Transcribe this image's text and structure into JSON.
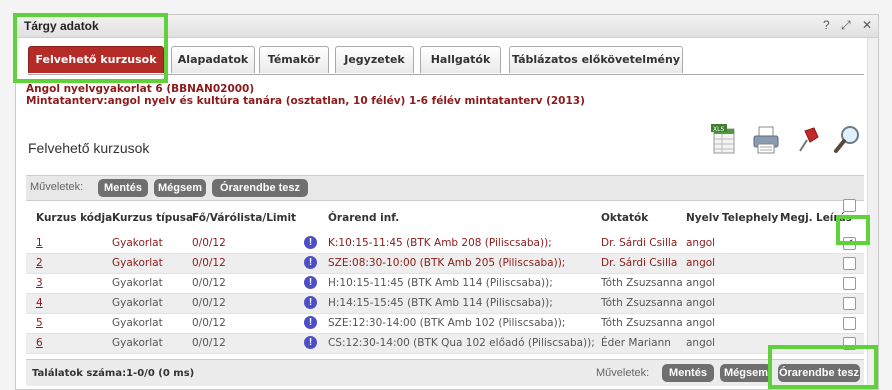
{
  "window": {
    "title": "Tárgy adatok",
    "help_icon": "?",
    "popout_icon": "⤢",
    "close_icon": "✕"
  },
  "tabs": [
    {
      "label": "Felvehető kurzusok",
      "active": true
    },
    {
      "label": "Alapadatok"
    },
    {
      "label": "Témakör"
    },
    {
      "label": "Jegyzetek"
    },
    {
      "label": "Hallgatók"
    },
    {
      "label": "Táblázatos előkövetelmény"
    }
  ],
  "course": {
    "line1": "Angol nyelvgyakorlat 6 (BBNAN02000)",
    "line2": "Mintatanterv:angol nyelv és kultúra tanára (osztatlan, 10 félév) 1-6 félév mintatanterv (2013)"
  },
  "section": {
    "title": "Felvehető kurzusok"
  },
  "toolbar": {
    "icons": [
      "xls-export-icon",
      "print-icon",
      "pin-icon",
      "search-icon"
    ]
  },
  "actions": {
    "label": "Műveletek:",
    "save": "Mentés",
    "cancel": "Mégsem",
    "schedule": "Órarendbe tesz"
  },
  "columns": {
    "code": "Kurzus kódja",
    "type": "Kurzus típusa",
    "limit": "Fő/Várólista/Limit",
    "schedule": "Órarend inf.",
    "teacher": "Oktatók",
    "lang": "Nyelv",
    "site": "Telephely",
    "note": "Megj.",
    "desc": "Leírás"
  },
  "rows": [
    {
      "code": "1",
      "type": "Gyakorlat",
      "limit": "0/0/12",
      "schedule": "K:10:15-11:45 (BTK Amb 208 (Piliscsaba));",
      "teacher": "Dr. Sárdi Csilla",
      "lang": "angol",
      "checked": "✔"
    },
    {
      "code": "2",
      "type": "Gyakorlat",
      "limit": "0/0/12",
      "schedule": "SZE:08:30-10:00 (BTK Amb 205 (Piliscsaba));",
      "teacher": "Dr. Sárdi Csilla",
      "lang": "angol",
      "checked": ""
    },
    {
      "code": "3",
      "type": "Gyakorlat",
      "limit": "0/0/12",
      "schedule": "H:10:15-11:45 (BTK Amb 114 (Piliscsaba));",
      "teacher": "Tóth Zsuzsanna",
      "lang": "angol",
      "checked": ""
    },
    {
      "code": "4",
      "type": "Gyakorlat",
      "limit": "0/0/12",
      "schedule": "H:14:15-15:45 (BTK Amb 114 (Piliscsaba));",
      "teacher": "Tóth Zsuzsanna",
      "lang": "angol",
      "checked": ""
    },
    {
      "code": "5",
      "type": "Gyakorlat",
      "limit": "0/0/12",
      "schedule": "SZE:12:30-14:00 (BTK Amb 102 (Piliscsaba));",
      "teacher": "Tóth Zsuzsanna",
      "lang": "angol",
      "checked": ""
    },
    {
      "code": "6",
      "type": "Gyakorlat",
      "limit": "0/0/12",
      "schedule": "CS:12:30-14:00 (BTK Qua 102 előadó (Piliscsaba));",
      "teacher": "Éder Mariann",
      "lang": "angol",
      "checked": ""
    }
  ],
  "footer": {
    "found": "Találatok száma:1-0/0 (0 ms)"
  },
  "colors": {
    "accent": "#b52b27",
    "text_red": "#8b1a1a",
    "highlight": "#5fd13a"
  }
}
